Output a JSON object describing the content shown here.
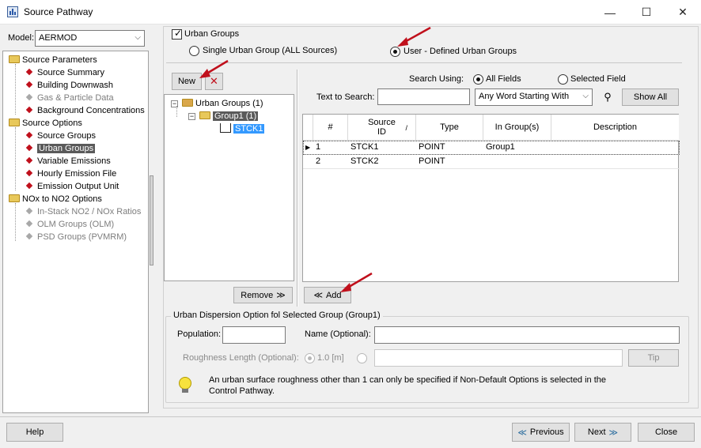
{
  "window": {
    "title": "Source Pathway",
    "minimize": "—",
    "maximize": "☐",
    "close": "✕"
  },
  "left": {
    "model_label": "Model:",
    "model_value": "AERMOD",
    "tree": {
      "source_parameters": "Source Parameters",
      "source_summary": "Source Summary",
      "building_downwash": "Building Downwash",
      "gas_particle": "Gas & Particle Data",
      "background": "Background Concentrations",
      "source_options": "Source Options",
      "source_groups": "Source Groups",
      "urban_groups": "Urban Groups",
      "variable_emissions": "Variable Emissions",
      "hourly_emission": "Hourly Emission File",
      "emission_output": "Emission Output Unit",
      "nox_no2": "NOx to NO2 Options",
      "instack": "In-Stack NO2 / NOx Ratios",
      "olm": "OLM Groups (OLM)",
      "psd": "PSD Groups (PVMRM)"
    }
  },
  "main": {
    "urban_groups_checkbox": "Urban Groups",
    "radio_single": "Single Urban Group (ALL Sources)",
    "radio_user": "User - Defined Urban Groups",
    "new_button": "New",
    "delete_icon": "✕",
    "group_tree": {
      "root": "Urban Groups (1)",
      "group": "Group1 (1)",
      "source": "STCK1"
    },
    "remove_button": "Remove",
    "add_button": "Add",
    "search_using_label": "Search Using:",
    "all_fields": "All Fields",
    "selected_field": "Selected Field",
    "text_to_search_label": "Text to Search:",
    "text_to_search_value": "",
    "search_mode": "Any Word Starting With",
    "show_all_button": "Show All",
    "table": {
      "headers": [
        "#",
        "Source ID",
        "Type",
        "In Group(s)",
        "Description"
      ],
      "rows": [
        {
          "num": "1",
          "id": "STCK1",
          "type": "POINT",
          "groups": "Group1",
          "desc": ""
        },
        {
          "num": "2",
          "id": "STCK2",
          "type": "POINT",
          "groups": "",
          "desc": ""
        }
      ]
    },
    "urban_section_title": "Urban Dispersion Option fol Selected Group (Group1)",
    "population_label": "Population:",
    "population_value": "",
    "name_label": "Name (Optional):",
    "name_value": "",
    "roughness_label": "Roughness Length (Optional):",
    "roughness_default": "1.0 [m]",
    "roughness_value": "",
    "tip_button": "Tip",
    "info_text_line1": "An urban surface roughness other than 1 can only be specified if Non-Default Options is selected in the",
    "info_text_line2": "Control Pathway."
  },
  "footer": {
    "help": "Help",
    "previous": "Previous",
    "next": "Next",
    "close": "Close"
  },
  "colors": {
    "annotation_arrow": "#c0101c",
    "selection": "#3399ff"
  }
}
